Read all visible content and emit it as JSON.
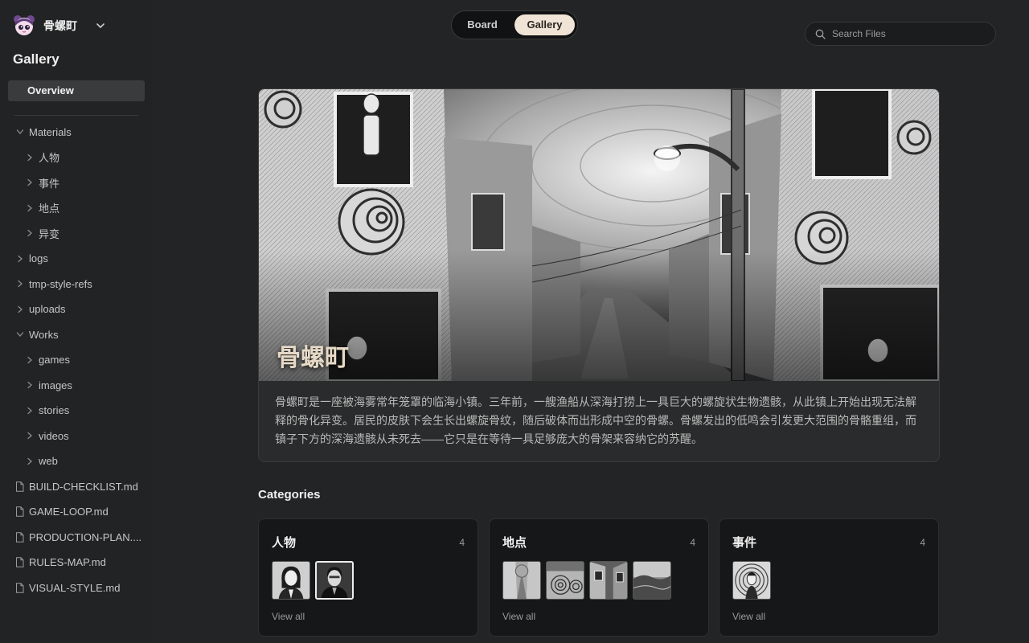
{
  "app": {
    "workspace_name": "骨螺町",
    "logo_icon": "mascot-logo-icon"
  },
  "sidebar": {
    "title": "Gallery",
    "overview_label": "Overview",
    "tree": [
      {
        "label": "Materials",
        "type": "folder",
        "expanded": true,
        "depth": 0
      },
      {
        "label": "人物",
        "type": "folder",
        "expanded": false,
        "depth": 1
      },
      {
        "label": "事件",
        "type": "folder",
        "expanded": false,
        "depth": 1
      },
      {
        "label": "地点",
        "type": "folder",
        "expanded": false,
        "depth": 1
      },
      {
        "label": "异变",
        "type": "folder",
        "expanded": false,
        "depth": 1
      },
      {
        "label": "logs",
        "type": "folder",
        "expanded": false,
        "depth": 0
      },
      {
        "label": "tmp-style-refs",
        "type": "folder",
        "expanded": false,
        "depth": 0
      },
      {
        "label": "uploads",
        "type": "folder",
        "expanded": false,
        "depth": 0
      },
      {
        "label": "Works",
        "type": "folder",
        "expanded": true,
        "depth": 0
      },
      {
        "label": "games",
        "type": "folder",
        "expanded": false,
        "depth": 1
      },
      {
        "label": "images",
        "type": "folder",
        "expanded": false,
        "depth": 1
      },
      {
        "label": "stories",
        "type": "folder",
        "expanded": false,
        "depth": 1
      },
      {
        "label": "videos",
        "type": "folder",
        "expanded": false,
        "depth": 1
      },
      {
        "label": "web",
        "type": "folder",
        "expanded": false,
        "depth": 1
      },
      {
        "label": "BUILD-CHECKLIST.md",
        "type": "file",
        "depth": 0
      },
      {
        "label": "GAME-LOOP.md",
        "type": "file",
        "depth": 0
      },
      {
        "label": "PRODUCTION-PLAN....",
        "type": "file",
        "depth": 0
      },
      {
        "label": "RULES-MAP.md",
        "type": "file",
        "depth": 0
      },
      {
        "label": "VISUAL-STYLE.md",
        "type": "file",
        "depth": 0
      }
    ]
  },
  "topbar": {
    "tabs": {
      "board": "Board",
      "gallery": "Gallery"
    },
    "active_tab": "Gallery",
    "search_placeholder": "Search Files",
    "search_value": ""
  },
  "hero": {
    "title": "骨螺町",
    "description": "骨螺町是一座被海雾常年笼罩的临海小镇。三年前，一艘渔船从深海打捞上一具巨大的螺旋状生物遗骸，从此镇上开始出现无法解释的骨化异变。居民的皮肤下会生长出螺旋骨纹，随后破体而出形成中空的骨螺。骨螺发出的低鸣会引发更大范围的骨骼重组，而镇子下方的深海遗骸从未死去——它只是在等待一具足够庞大的骨架来容纳它的苏醒。"
  },
  "categories": {
    "heading": "Categories",
    "items": [
      {
        "name": "人物",
        "count": "4",
        "view_all": "View all",
        "thumbs": [
          "portrait-woman-thumb",
          "portrait-man-thumb"
        ]
      },
      {
        "name": "地点",
        "count": "4",
        "view_all": "View all",
        "thumbs": [
          "street-thumb",
          "spiral-wall-thumb",
          "alley-thumb",
          "landscape-thumb"
        ]
      },
      {
        "name": "事件",
        "count": "4",
        "view_all": "View all",
        "thumbs": [
          "spiral-figure-thumb"
        ]
      }
    ]
  },
  "colors": {
    "background": "#232425",
    "active_tab_bg": "#f0e4d6",
    "hero_title": "#e6d9c6"
  }
}
